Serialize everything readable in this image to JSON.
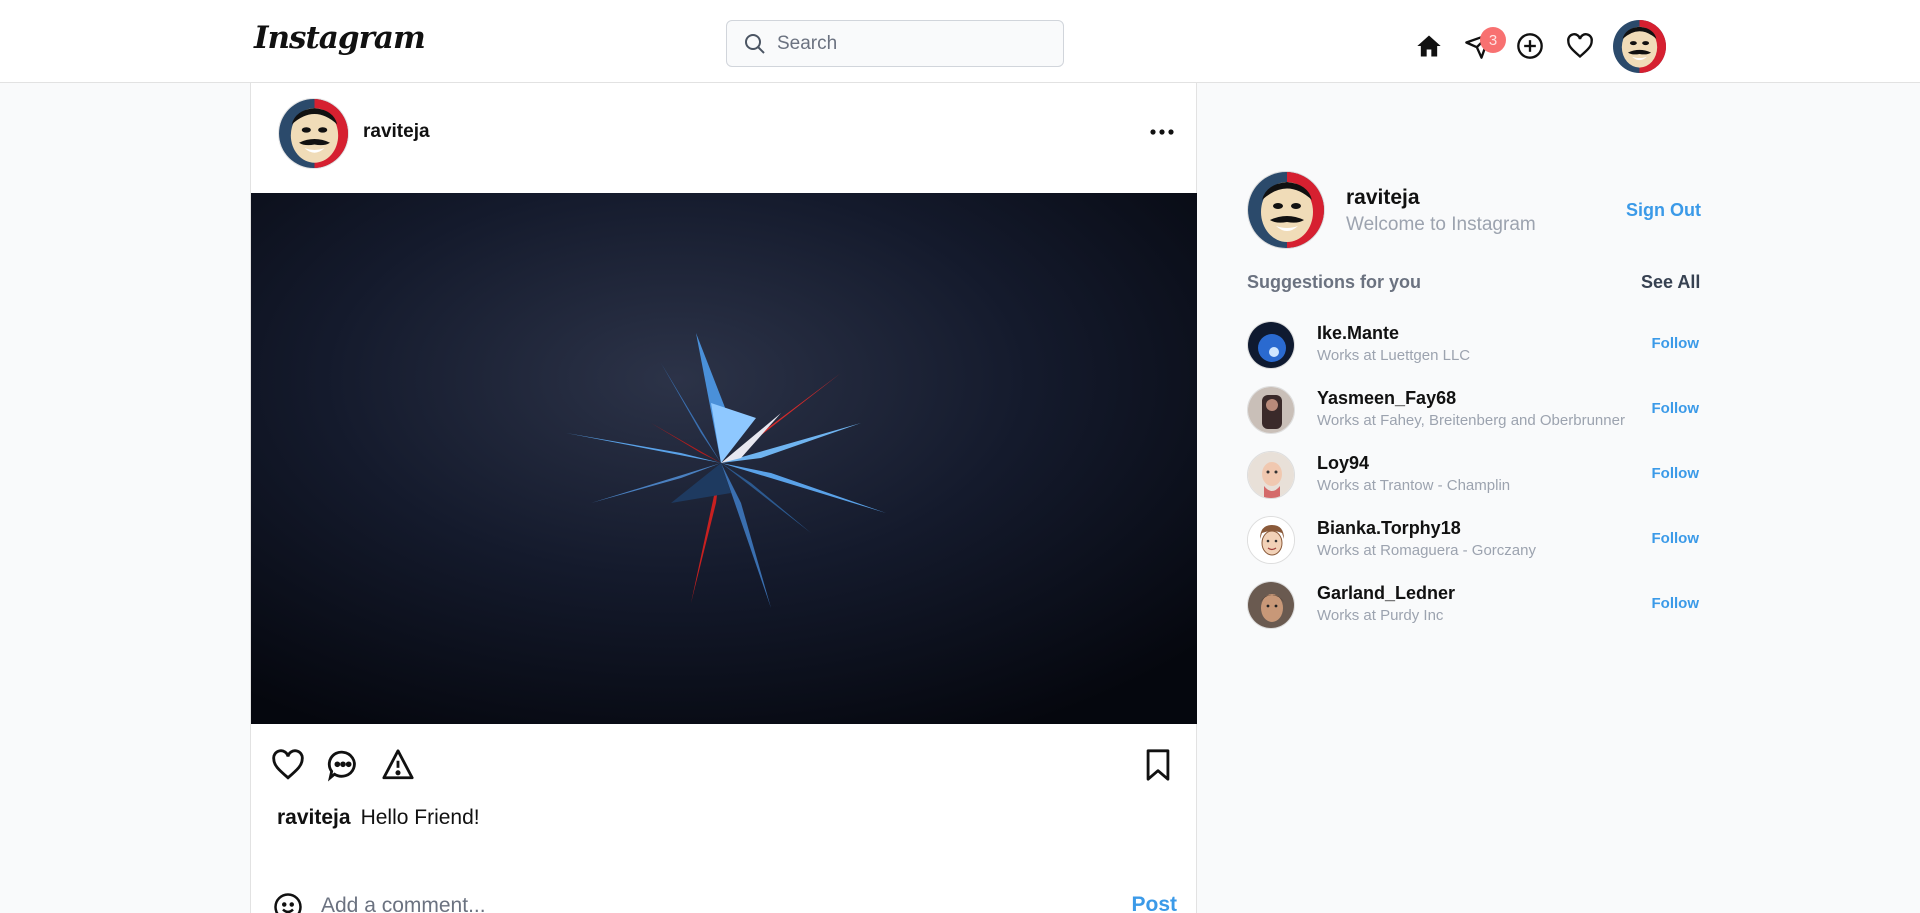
{
  "header": {
    "logo": "Instagram",
    "search_placeholder": "Search",
    "messages_badge": "3",
    "icons": [
      "home-icon",
      "paper-plane-icon",
      "plus-circle-icon",
      "heart-icon"
    ]
  },
  "post": {
    "username": "raviteja",
    "caption_user": "raviteja",
    "caption_text": "Hello Friend!",
    "comment_placeholder": "Add a comment...",
    "post_label": "Post"
  },
  "profile": {
    "username": "raviteja",
    "subtitle": "Welcome to Instagram",
    "sign_out": "Sign Out"
  },
  "suggestions": {
    "title": "Suggestions for you",
    "see_all": "See All",
    "items": [
      {
        "name": "Ike.Mante",
        "works": "Works at Luettgen LLC",
        "follow": "Follow"
      },
      {
        "name": "Yasmeen_Fay68",
        "works": "Works at Fahey, Breitenberg and Oberbrunner",
        "follow": "Follow"
      },
      {
        "name": "Loy94",
        "works": "Works at Trantow - Champlin",
        "follow": "Follow"
      },
      {
        "name": "Bianka.Torphy18",
        "works": "Works at Romaguera - Gorczany",
        "follow": "Follow"
      },
      {
        "name": "Garland_Ledner",
        "works": "Works at Purdy Inc",
        "follow": "Follow"
      }
    ]
  },
  "colors": {
    "accent": "#3b9ae8",
    "badge": "#f87171",
    "muted": "#9ca3af"
  }
}
